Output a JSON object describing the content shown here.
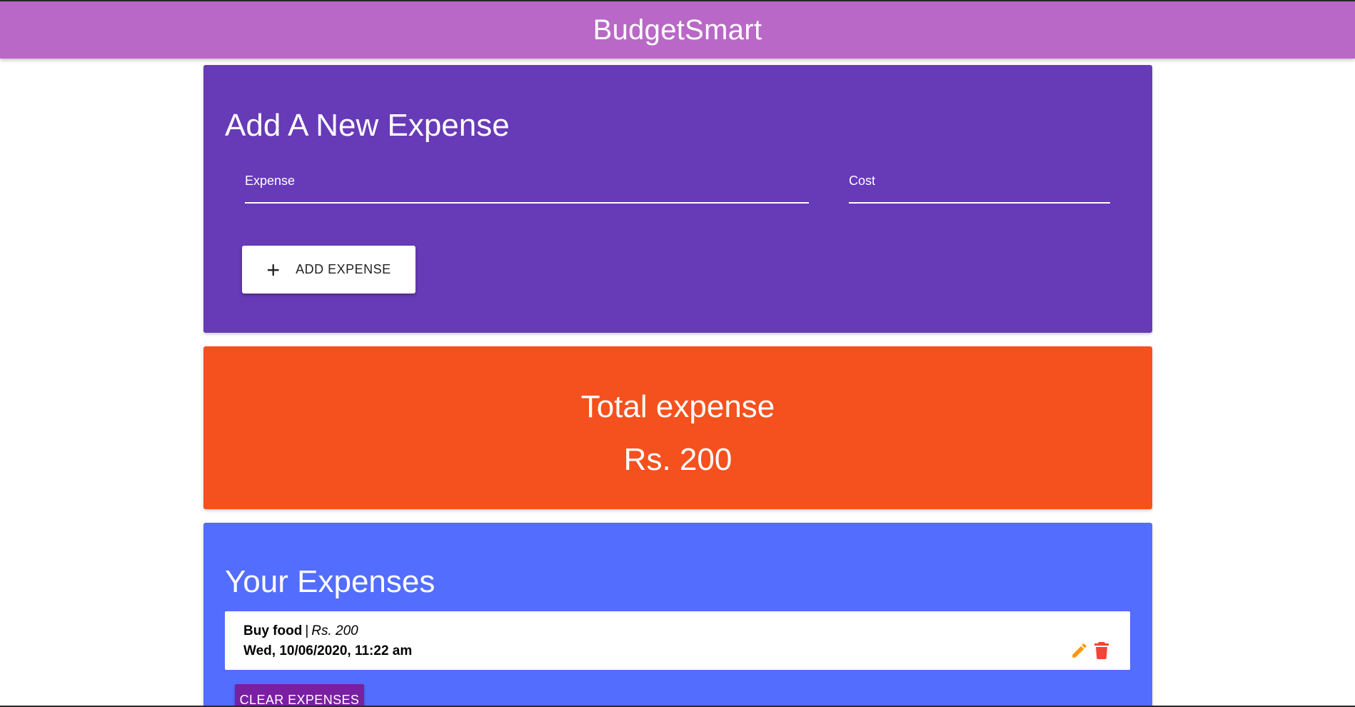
{
  "app": {
    "title": "BudgetSmart"
  },
  "add_form": {
    "heading": "Add A New Expense",
    "expense_label": "Expense",
    "expense_value": "",
    "cost_label": "Cost",
    "cost_value": "",
    "add_button_label": "ADD EXPENSE",
    "add_button_icon": "plus-icon"
  },
  "total": {
    "title": "Total expense",
    "value": "Rs. 200"
  },
  "expenses": {
    "heading": "Your Expenses",
    "items": [
      {
        "name": "Buy food",
        "separator": "|",
        "cost": "Rs. 200",
        "date": "Wed, 10/06/2020, 11:22 am",
        "edit_icon": "pencil-icon",
        "delete_icon": "trash-icon"
      }
    ],
    "clear_button_label": "CLEAR EXPENSES"
  },
  "colors": {
    "header": "#b968c7",
    "add_card": "#673ab7",
    "total_card": "#f4511e",
    "list_card": "#536dfe",
    "clear_button": "#7b1fa2",
    "edit_icon": "#ff9800",
    "delete_icon": "#f44336"
  }
}
